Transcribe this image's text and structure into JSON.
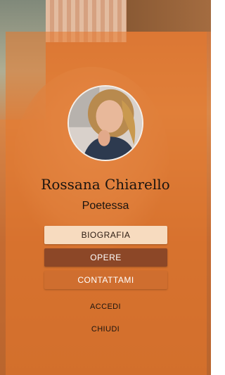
{
  "profile": {
    "name": "Rossana Chiarello",
    "role": "Poetessa"
  },
  "menu": {
    "biografia": "BIOGRAFIA",
    "opere": "OPERE",
    "contattami": "CONTATTAMI",
    "accedi": "ACCEDI",
    "chiudi": "CHIUDI"
  },
  "colors": {
    "overlay": "#e8782c",
    "biografia_button": "#f7dbbf",
    "opere_button": "#8c4727",
    "contattami_button": "#cf6e2f"
  }
}
